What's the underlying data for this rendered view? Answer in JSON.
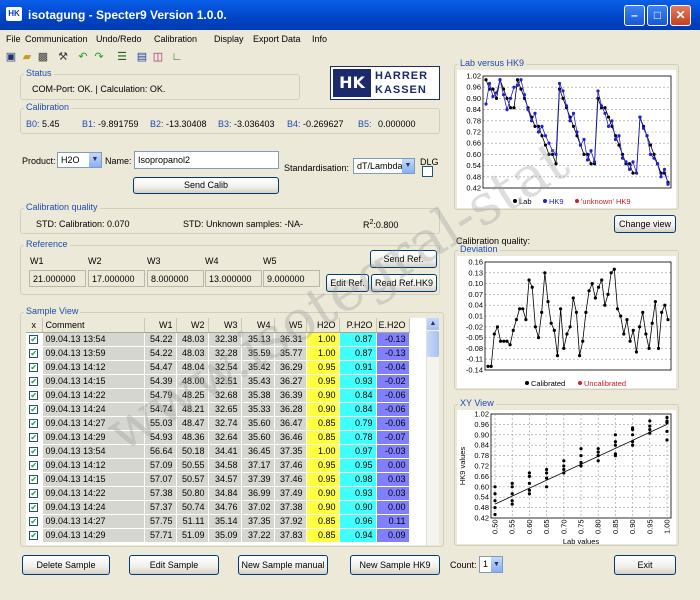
{
  "window": {
    "title": "isotagung - Specter9  Version 1.0.0.",
    "icon_text": "HK"
  },
  "menu": [
    "File",
    "Communication",
    "Undo/Redo",
    "Calibration",
    "Display",
    "Export Data",
    "Info"
  ],
  "toolbar_icons": [
    "save-icon",
    "open-icon",
    "print-icon",
    "tool-icon",
    "undo-icon",
    "redo-icon",
    "chart-edit-icon",
    "window-icon",
    "chart-icon",
    "chart-line-icon"
  ],
  "status": {
    "label": "Status",
    "text": "COM-Port: OK.  |  Calculation: OK."
  },
  "logo": {
    "left": "HK",
    "line1": "HARRER",
    "line2": "KASSEN"
  },
  "calibration": {
    "label": "Calibration",
    "b0_label": "B0:",
    "b0": "5.45",
    "b1_label": "B1:",
    "b1": "-9.891759",
    "b2_label": "B2:",
    "b2": "-13.30408",
    "b3_label": "B3:",
    "b3": "-3.036403",
    "b4_label": "B4:",
    "b4": "-0.269627",
    "b5_label": "B5:",
    "b5": "0.000000"
  },
  "product": {
    "label": "Product:",
    "value": "H2O",
    "name_label": "Name:",
    "name_value": "Isopropanol2",
    "std_label": "Standardisation:",
    "std_value": "dT/Lambda",
    "dlg_label": "DLG",
    "send_calib": "Send Calib"
  },
  "quality": {
    "label": "Calibration quality",
    "std_cal": "STD: Calibration: 0.070",
    "std_unknown": "STD: Unknown samples: -NA-",
    "r2_label": "R",
    "r2_sup": "2",
    "r2_value": ":0.800"
  },
  "reference": {
    "label": "Reference",
    "headers": [
      "W1",
      "W2",
      "W3",
      "W4",
      "W5"
    ],
    "values": [
      "21.000000",
      "17.000000",
      "8.000000",
      "13.000000",
      "9.000000"
    ],
    "send_ref": "Send Ref.",
    "edit_ref": "Edit Ref.",
    "read_ref": "Read Ref.HK9"
  },
  "sample_view": {
    "label": "Sample View",
    "columns": [
      "x",
      "Comment",
      "W1",
      "W2",
      "W3",
      "W4",
      "W5",
      "H2O",
      "P.H2O",
      "E.H2O"
    ],
    "rows": [
      [
        "09.04.13 13:54",
        "54.22",
        "48.03",
        "32.38",
        "35.13",
        "36.31",
        "1.00",
        "0.87",
        "-0.13"
      ],
      [
        "09.04.13 13:59",
        "54.22",
        "48.03",
        "32.28",
        "35.59",
        "35.77",
        "1.00",
        "0.87",
        "-0.13"
      ],
      [
        "09.04.13 14:12",
        "54.47",
        "48.04",
        "32.54",
        "35.42",
        "36.29",
        "0.95",
        "0.91",
        "-0.04"
      ],
      [
        "09.04.13 14:15",
        "54.39",
        "48.00",
        "32.51",
        "35.43",
        "36.27",
        "0.95",
        "0.93",
        "-0.02"
      ],
      [
        "09.04.13 14:22",
        "54.79",
        "48.25",
        "32.68",
        "35.38",
        "36.39",
        "0.90",
        "0.84",
        "-0.06"
      ],
      [
        "09.04.13 14:24",
        "54.74",
        "48.21",
        "32.65",
        "35.33",
        "36.28",
        "0.90",
        "0.84",
        "-0.06"
      ],
      [
        "09.04.13 14:27",
        "55.03",
        "48.47",
        "32.74",
        "35.60",
        "36.47",
        "0.85",
        "0.79",
        "-0.06"
      ],
      [
        "09.04.13 14:29",
        "54.93",
        "48.36",
        "32.64",
        "35.60",
        "36.46",
        "0.85",
        "0.78",
        "-0.07"
      ],
      [
        "09.04.13 13:54",
        "56.64",
        "50.18",
        "34.41",
        "36.45",
        "37.35",
        "1.00",
        "0.97",
        "-0.03"
      ],
      [
        "09.04.13 14:12",
        "57.09",
        "50.55",
        "34.58",
        "37.17",
        "37.46",
        "0.95",
        "0.95",
        "0.00"
      ],
      [
        "09.04.13 14:15",
        "57.07",
        "50.57",
        "34.57",
        "37.39",
        "37.46",
        "0.95",
        "0.98",
        "0.03"
      ],
      [
        "09.04.13 14:22",
        "57.38",
        "50.80",
        "34.84",
        "36.99",
        "37.49",
        "0.90",
        "0.93",
        "0.03"
      ],
      [
        "09.04.13 14:24",
        "57.37",
        "50.74",
        "34.76",
        "37.02",
        "37.38",
        "0.90",
        "0.90",
        "0.00"
      ],
      [
        "09.04.13 14:27",
        "57.75",
        "51.11",
        "35.14",
        "37.35",
        "37.92",
        "0.85",
        "0.96",
        "0.11"
      ],
      [
        "09.04.13 14:29",
        "57.71",
        "51.09",
        "35.09",
        "37.22",
        "37.83",
        "0.85",
        "0.94",
        "0.09"
      ]
    ]
  },
  "buttons": {
    "delete": "Delete Sample",
    "edit": "Edit Sample",
    "new_manual": "New Sample manual",
    "new_hk9": "New Sample HK9",
    "count_label": "Count:",
    "count_value": "1",
    "exit": "Exit",
    "change_view": "Change view"
  },
  "watermark": "www.isotegral-stat",
  "chart_data": [
    {
      "type": "line",
      "title": "Lab versus HK9",
      "yticks": [
        "1.02",
        "0.96",
        "0.90",
        "0.84",
        "0.78",
        "0.72",
        "0.66",
        "0.60",
        "0.54",
        "0.48",
        "0.42"
      ],
      "ylim": [
        0.42,
        1.02
      ],
      "legend": [
        "Lab",
        "HK9",
        "'unknown' HK9"
      ],
      "legend_colors": [
        "#000000",
        "#2020D0",
        "#D02020"
      ],
      "series": [
        {
          "name": "Lab",
          "color": "#000000",
          "values": [
            1.0,
            0.95,
            0.95,
            0.9,
            1.0,
            0.95,
            0.9,
            0.85,
            0.85,
            1.0,
            0.95,
            0.9,
            0.85,
            0.8,
            0.75,
            0.75,
            0.7,
            0.65,
            0.6,
            0.6,
            0.55,
            0.95,
            0.9,
            0.85,
            0.8,
            0.75,
            0.7,
            0.65,
            0.6,
            0.6,
            0.55,
            0.55,
            0.9,
            0.85,
            0.85,
            0.8,
            0.75,
            0.7,
            0.65,
            0.6,
            0.55,
            0.55,
            0.5,
            0.5,
            0.8,
            0.75,
            0.7,
            0.65,
            0.6,
            0.55,
            0.5,
            0.5,
            0.45
          ]
        },
        {
          "name": "HK9",
          "color": "#2020D0",
          "values": [
            0.87,
            0.98,
            0.91,
            0.93,
            1.0,
            0.92,
            0.84,
            0.9,
            0.96,
            0.97,
            1.0,
            0.92,
            0.84,
            0.78,
            0.82,
            0.72,
            0.75,
            0.7,
            0.66,
            0.62,
            0.6,
            0.98,
            0.94,
            0.86,
            0.78,
            0.82,
            0.72,
            0.65,
            0.68,
            0.57,
            0.62,
            0.56,
            0.94,
            0.86,
            0.82,
            0.75,
            0.78,
            0.68,
            0.7,
            0.58,
            0.56,
            0.52,
            0.56,
            0.5,
            0.8,
            0.74,
            0.7,
            0.6,
            0.58,
            0.55,
            0.48,
            0.52,
            0.44
          ]
        }
      ]
    },
    {
      "type": "line",
      "title": "Deviation",
      "header": "Calibration quality:",
      "yticks": [
        "0.16",
        "0.13",
        "0.10",
        "0.07",
        "0.04",
        "0.01",
        "-0.02",
        "-0.05",
        "-0.08",
        "-0.11",
        "-0.14"
      ],
      "ylim": [
        -0.14,
        0.16
      ],
      "legend": [
        "Calibrated",
        "Uncalibrated"
      ],
      "legend_colors": [
        "#000000",
        "#D02020"
      ],
      "series": [
        {
          "name": "Calibrated",
          "color": "#000000",
          "values": [
            -0.13,
            -0.13,
            -0.04,
            -0.02,
            -0.06,
            -0.06,
            -0.06,
            -0.07,
            -0.03,
            0.0,
            0.03,
            0.03,
            0.0,
            0.11,
            0.09,
            -0.02,
            -0.05,
            0.02,
            0.13,
            0.05,
            -0.01,
            -0.03,
            -0.1,
            0.03,
            -0.08,
            -0.04,
            -0.02,
            0.06,
            0.02,
            -0.1,
            -0.06,
            0.02,
            0.08,
            0.1,
            0.06,
            0.09,
            0.11,
            0.04,
            0.07,
            0.13,
            0.14,
            0.03,
            0.01,
            -0.04,
            0.0,
            -0.06,
            -0.03,
            -0.09,
            -0.02,
            0.02,
            -0.04,
            -0.08,
            -0.01,
            0.05,
            -0.08,
            0.02,
            0.04,
            0.0
          ]
        }
      ]
    },
    {
      "type": "scatter",
      "title": "XY View",
      "xlabel": "Lab values",
      "ylabel": "HK9 values",
      "xticks": [
        "0.50",
        "0.55",
        "0.60",
        "0.65",
        "0.70",
        "0.75",
        "0.80",
        "0.85",
        "0.90",
        "0.95",
        "1.00"
      ],
      "xlim": [
        0.5,
        1.0
      ],
      "yticks": [
        "1.02",
        "0.96",
        "0.90",
        "0.84",
        "0.78",
        "0.72",
        "0.66",
        "0.60",
        "0.54",
        "0.48",
        "0.42"
      ],
      "ylim": [
        0.42,
        1.02
      ],
      "points": [
        [
          0.5,
          0.48
        ],
        [
          0.5,
          0.52
        ],
        [
          0.5,
          0.56
        ],
        [
          0.5,
          0.6
        ],
        [
          0.5,
          0.44
        ],
        [
          0.55,
          0.56
        ],
        [
          0.55,
          0.6
        ],
        [
          0.55,
          0.62
        ],
        [
          0.55,
          0.52
        ],
        [
          0.55,
          0.5
        ],
        [
          0.6,
          0.58
        ],
        [
          0.6,
          0.62
        ],
        [
          0.6,
          0.66
        ],
        [
          0.6,
          0.56
        ],
        [
          0.6,
          0.68
        ],
        [
          0.65,
          0.65
        ],
        [
          0.65,
          0.68
        ],
        [
          0.65,
          0.7
        ],
        [
          0.65,
          0.6
        ],
        [
          0.7,
          0.68
        ],
        [
          0.7,
          0.72
        ],
        [
          0.7,
          0.75
        ],
        [
          0.7,
          0.7
        ],
        [
          0.75,
          0.72
        ],
        [
          0.75,
          0.78
        ],
        [
          0.75,
          0.82
        ],
        [
          0.75,
          0.74
        ],
        [
          0.8,
          0.75
        ],
        [
          0.8,
          0.78
        ],
        [
          0.8,
          0.8
        ],
        [
          0.8,
          0.82
        ],
        [
          0.85,
          0.78
        ],
        [
          0.85,
          0.79
        ],
        [
          0.85,
          0.84
        ],
        [
          0.85,
          0.86
        ],
        [
          0.85,
          0.9
        ],
        [
          0.9,
          0.84
        ],
        [
          0.9,
          0.86
        ],
        [
          0.9,
          0.9
        ],
        [
          0.9,
          0.93
        ],
        [
          0.9,
          0.94
        ],
        [
          0.95,
          0.91
        ],
        [
          0.95,
          0.93
        ],
        [
          0.95,
          0.95
        ],
        [
          0.95,
          0.98
        ],
        [
          1.0,
          0.87
        ],
        [
          1.0,
          0.92
        ],
        [
          1.0,
          0.97
        ],
        [
          1.0,
          0.98
        ],
        [
          1.0,
          1.0
        ]
      ],
      "trend": [
        [
          0.5,
          0.5
        ],
        [
          1.0,
          0.96
        ]
      ]
    }
  ]
}
